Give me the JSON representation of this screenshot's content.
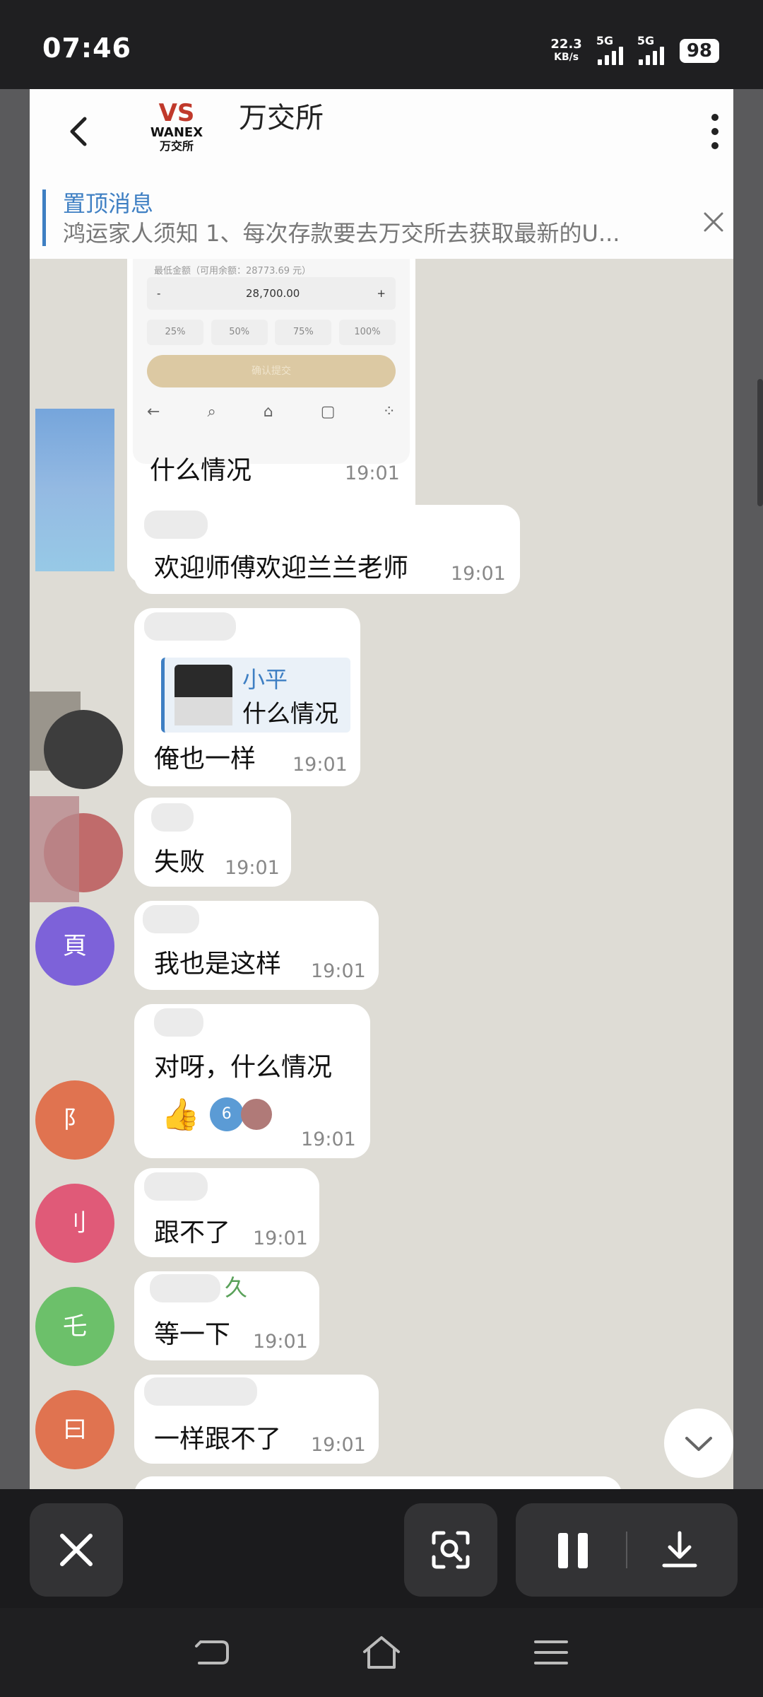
{
  "status_bar": {
    "time": "07:46",
    "net_speed_value": "22.3",
    "net_speed_unit": "KB/s",
    "sim1": "5G",
    "sim2": "5G",
    "battery": "98"
  },
  "chat_header": {
    "logo_vs": "VS",
    "logo_brand": "WANEX",
    "logo_cn": "万交所",
    "title": "万交所"
  },
  "pinned": {
    "label": "置顶消息",
    "text": "鸿运家人须知  1、每次存款要去万交所去获取最新的U..."
  },
  "screenshot_preview": {
    "caption": "最低金额（可用余额：28773.69 元）",
    "minus": "-",
    "amount": "28,700.00",
    "plus": "+",
    "percents": [
      "25%",
      "50%",
      "75%",
      "100%"
    ],
    "confirm": "确认提交"
  },
  "messages": [
    {
      "text": "什么情况",
      "time": "19:01"
    },
    {
      "text": "欢迎师傅欢迎兰兰老师",
      "time": "19:01"
    },
    {
      "quote_name": "小平",
      "quote_text": "什么情况",
      "text": "俺也一样",
      "time": "19:01"
    },
    {
      "text": "失败",
      "time": "19:01"
    },
    {
      "text": "我也是这样",
      "time": "19:01"
    },
    {
      "text": "对呀，什么情况",
      "time": "19:01",
      "reaction_count": "6"
    },
    {
      "text": "跟不了",
      "time": "19:01"
    },
    {
      "sender": "久",
      "text": "等一下",
      "time": "19:01"
    },
    {
      "text": "一样跟不了",
      "time": "19:01"
    }
  ],
  "avatar_letters": [
    "阝",
    "頁",
    "刂",
    "乇",
    "曰"
  ],
  "colors": {
    "accent": "#3e7fc3",
    "chat_bg": "#dedcd5",
    "bubble": "#ffffff",
    "timestamp": "#888888"
  },
  "icons": {
    "back": "chevron-left-icon",
    "more": "more-vertical-icon",
    "close_pin": "close-icon",
    "scroll_down": "chevron-down-icon",
    "close_player": "close-icon",
    "scan": "screen-scan-icon",
    "pause": "pause-icon",
    "download": "download-icon",
    "nav_back": "back-icon",
    "nav_home": "home-icon",
    "nav_menu": "menu-icon"
  }
}
